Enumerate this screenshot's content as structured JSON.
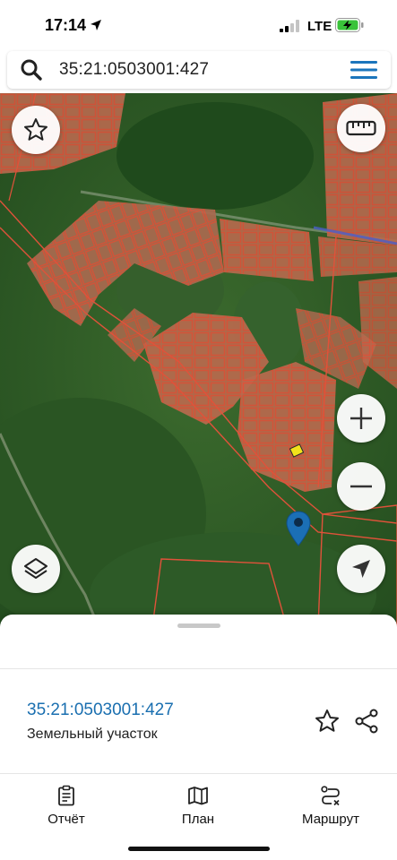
{
  "status_bar": {
    "time": "17:14",
    "carrier": "LTE",
    "icons": [
      "location-arrow-icon",
      "signal-icon",
      "battery-charging-icon"
    ]
  },
  "search": {
    "query": "35:21:0503001:427",
    "icon": "search-icon",
    "menu_icon": "hamburger-menu-icon"
  },
  "map": {
    "type": "satellite",
    "overlay_color": "#e0523a",
    "selected_parcel_color": "#f2e21b",
    "pin_color": "#1b6fb5",
    "buttons": [
      "favorite-star-icon",
      "ruler-icon",
      "zoom-in-icon",
      "zoom-out-icon",
      "layers-icon",
      "locate-arrow-icon"
    ]
  },
  "sheet": {
    "parcel_number": "35:21:0503001:427",
    "parcel_type": "Земельный участок",
    "tabs": [
      {
        "label": "Отчёт",
        "icon": "report-clipboard-icon"
      },
      {
        "label": "План",
        "icon": "plan-map-icon"
      },
      {
        "label": "Маршрут",
        "icon": "route-icon"
      }
    ]
  },
  "colors": {
    "accent": "#1a6fb0",
    "menu_blue": "#1b75bc"
  }
}
